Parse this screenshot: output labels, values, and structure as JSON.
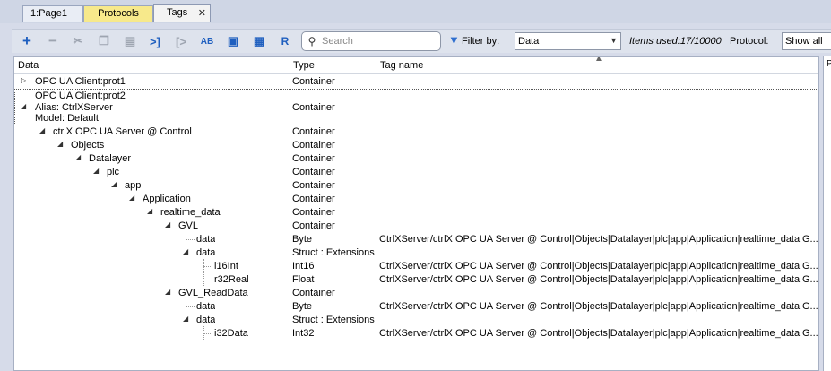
{
  "tabs": [
    {
      "label": "1:Page1"
    },
    {
      "label": "Protocols"
    },
    {
      "label": "Tags",
      "close": "✕"
    }
  ],
  "toolbar": {
    "search_placeholder": "Search",
    "filter_label": "Filter by:",
    "filter_value": "Data",
    "items_used": "Items used:17/10000",
    "protocol_label": "Protocol:",
    "protocol_value": "Show all"
  },
  "columns": {
    "data": "Data",
    "type": "Type",
    "tag_name": "Tag name"
  },
  "rows": [
    {
      "name": "OPC UA Client:prot1",
      "type": "Container",
      "tag": ""
    },
    {
      "line1": "OPC UA Client:prot2",
      "line2": "Alias: CtrlXServer",
      "line3": "Model: Default",
      "type": "Container",
      "tag": ""
    },
    {
      "name": "ctrlX OPC UA Server @ Control",
      "type": "Container",
      "tag": ""
    },
    {
      "name": "Objects",
      "type": "Container",
      "tag": ""
    },
    {
      "name": "Datalayer",
      "type": "Container",
      "tag": ""
    },
    {
      "name": "plc",
      "type": "Container",
      "tag": ""
    },
    {
      "name": "app",
      "type": "Container",
      "tag": ""
    },
    {
      "name": "Application",
      "type": "Container",
      "tag": ""
    },
    {
      "name": "realtime_data",
      "type": "Container",
      "tag": ""
    },
    {
      "name": "GVL",
      "type": "Container",
      "tag": ""
    },
    {
      "name": "data",
      "type": "Byte",
      "tag": "CtrlXServer/ctrlX OPC UA Server @ Control|Objects|Datalayer|plc|app|Application|realtime_data|G..."
    },
    {
      "name": "data",
      "type": "Struct : Extensions",
      "tag": ""
    },
    {
      "name": "i16Int",
      "type": "Int16",
      "tag": "CtrlXServer/ctrlX OPC UA Server @ Control|Objects|Datalayer|plc|app|Application|realtime_data|G..."
    },
    {
      "name": "r32Real",
      "type": "Float",
      "tag": "CtrlXServer/ctrlX OPC UA Server @ Control|Objects|Datalayer|plc|app|Application|realtime_data|G..."
    },
    {
      "name": "GVL_ReadData",
      "type": "Container",
      "tag": ""
    },
    {
      "name": "data",
      "type": "Byte",
      "tag": "CtrlXServer/ctrlX OPC UA Server @ Control|Objects|Datalayer|plc|app|Application|realtime_data|G..."
    },
    {
      "name": "data",
      "type": "Struct : Extensions",
      "tag": ""
    },
    {
      "name": "i32Data",
      "type": "Int32",
      "tag": "CtrlXServer/ctrlX OPC UA Server @ Control|Objects|Datalayer|plc|app|Application|realtime_data|G..."
    }
  ],
  "right_pane_label": "P"
}
